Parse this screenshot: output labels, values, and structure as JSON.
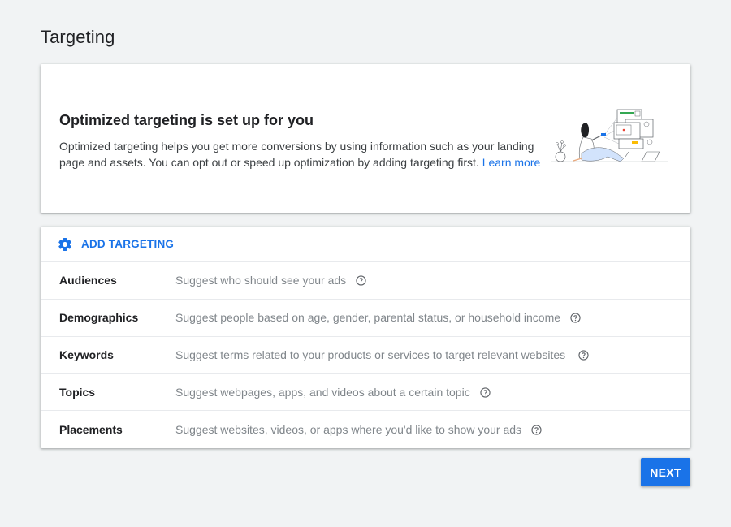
{
  "page": {
    "title": "Targeting"
  },
  "hero": {
    "title": "Optimized targeting is set up for you",
    "description": "Optimized targeting helps you get more conversions by using information such as your landing page and assets. You can opt out or speed up optimization by adding targeting first.",
    "link_label": "Learn more",
    "illustration": "person-with-ad-screens-illustration"
  },
  "targeting": {
    "add_label": "ADD TARGETING",
    "add_icon": "gear-icon",
    "rows": [
      {
        "label": "Audiences",
        "description": "Suggest who should see your ads",
        "icon": "help-icon"
      },
      {
        "label": "Demographics",
        "description": "Suggest people based on age, gender, parental status, or household income",
        "icon": "help-icon"
      },
      {
        "label": "Keywords",
        "description": "Suggest terms related to your products or services to target relevant websites",
        "icon": "help-icon"
      },
      {
        "label": "Topics",
        "description": "Suggest webpages, apps, and videos about a certain topic",
        "icon": "help-icon"
      },
      {
        "label": "Placements",
        "description": "Suggest websites, videos, or apps where you'd like to show your ads",
        "icon": "help-icon"
      }
    ]
  },
  "actions": {
    "next_label": "NEXT"
  },
  "colors": {
    "accent": "#1a73e8",
    "background": "#f1f3f4",
    "text_primary": "#202124",
    "text_secondary": "#80868b"
  }
}
